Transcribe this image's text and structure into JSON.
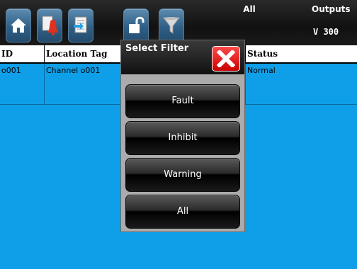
{
  "toolbar": {
    "icons": [
      "home-icon",
      "alarm-bell-icon",
      "export-document-icon",
      "unlock-icon",
      "filter-funnel-icon"
    ],
    "mode": "All",
    "output_label": "Outputs",
    "output_value": "V 300"
  },
  "table": {
    "columns": [
      "ID",
      "Location Tag",
      "Status"
    ],
    "rows": [
      {
        "id": "o001",
        "location_tag": "Channel o001",
        "status": "Normal"
      }
    ]
  },
  "modal": {
    "title": "Select Filter",
    "options": [
      "Fault",
      "Inhibit",
      "Warning",
      "All"
    ]
  },
  "colors": {
    "toolbar_bg": "#111111",
    "table_body_bg": "#0f9fe8",
    "close_red": "#e00000",
    "icon_button": "#3a6d95"
  }
}
